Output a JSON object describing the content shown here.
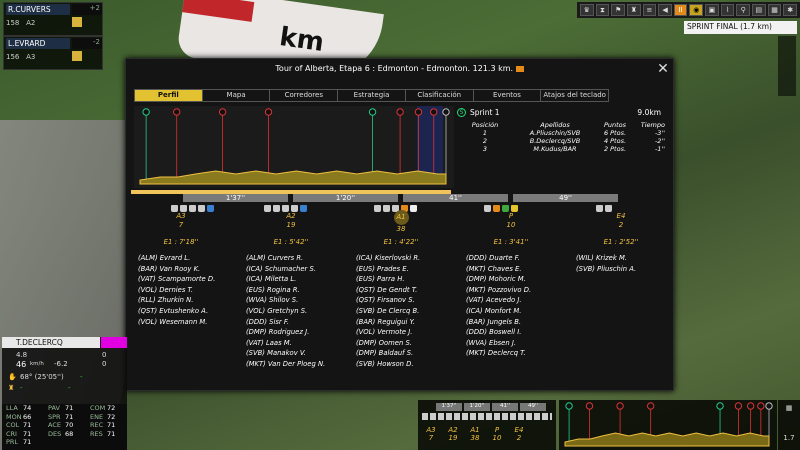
{
  "top_riders": [
    {
      "name": "R.CURVERS",
      "badge": "+2",
      "num": "158",
      "gap": "A2"
    },
    {
      "name": "L.EVRARD",
      "badge": "-2",
      "num": "156",
      "gap": "A3"
    }
  ],
  "toolbar": {
    "speed": "II",
    "sprint_final_label": "SPRINT FINAL (1.7 km)"
  },
  "banner_text": "km",
  "modal": {
    "title": "Tour of Alberta, Etapa 6 : Edmonton - Edmonton. 121.3 km.",
    "tabs": [
      "Perfil",
      "Mapa",
      "Corredores",
      "Estrategia",
      "Clasificación",
      "Eventos",
      "Atajos del teclado"
    ],
    "active_tab": "Perfil",
    "sprint": {
      "title": "Sprint 1",
      "distance": "9.0km",
      "headers": [
        "Posición",
        "Apellidos",
        "Puntos",
        "Tiempo"
      ],
      "rows": [
        [
          "1",
          "A.Pliuschin/SVB",
          "6 Ptos.",
          "-3''"
        ],
        [
          "2",
          "B.Declercq/SVB",
          "4 Ptos.",
          "-2''"
        ],
        [
          "3",
          "M.Kudus/BAR",
          "2 Ptos.",
          "-1''"
        ]
      ]
    },
    "gaps": [
      "1'37''",
      "1'20''",
      "41''",
      "49''"
    ],
    "groups": [
      {
        "label": "A3",
        "count": "7",
        "time": "E1 : 7'18''",
        "riders": [
          "(ALM) Evrard L.",
          "(BAR) Van Rooy K.",
          "(VAT) Scampamorte D.",
          "(VOL) Dernies T.",
          "(RLL) Zhurkin N.",
          "(QST) Evtushenko A.",
          "(VOL) Wesemann M."
        ]
      },
      {
        "label": "A2",
        "count": "19",
        "time": "E1 : 5'42''",
        "riders": [
          "(ALM) Curvers R.",
          "(ICA) Schumacher S.",
          "(ICA) Miletta L.",
          "(EUS) Rogina R.",
          "(WVA) Shilov S.",
          "(VOL) Gretchyn S.",
          "(DDD) Sisr F.",
          "(DMP) Rodriguez J.",
          "(VAT) Laas M.",
          "(SVB) Manakov V.",
          "(MKT) Van Der Ploeg N."
        ]
      },
      {
        "label": "A1",
        "count": "38",
        "time": "E1 : 4'22''",
        "riders": [
          "(ICA) Kiserlovski R.",
          "(EUS) Prades E.",
          "(EUS) Parra H.",
          "(QST) De Gendt T.",
          "(QST) Firsanov S.",
          "(SVB) De Clercq B.",
          "(BAR) Reguigui Y.",
          "(VOL) Vermote J.",
          "(DMP) Oomen S.",
          "(DMP) Baldauf S.",
          "(SVB) Howson D."
        ]
      },
      {
        "label": "P",
        "count": "10",
        "time": "E1 : 3'41''",
        "riders": [
          "(DDD) Duarte F.",
          "(MKT) Chaves E.",
          "(DMP) Mohoric M.",
          "(MKT) Pozzovivo D.",
          "(VAT) Acevedo J.",
          "(ICA) Monfort M.",
          "(BAR) Jungels B.",
          "(DDD) Boswell I.",
          "(WVA) Ebsen J.",
          "(MKT) Declercq T."
        ]
      },
      {
        "label": "E4",
        "count": "2",
        "time": "E1 : 2'52''",
        "riders": [
          "(WIL) Krizek M.",
          "(SVB) Pliuschin A."
        ]
      }
    ]
  },
  "rider_panel": {
    "name": "T.DECLERCQ",
    "val1": "4.8",
    "val2": "0",
    "speed": "46",
    "speed_unit": "km/h",
    "slope": "-6.2",
    "slope2": "0",
    "energy": "68° (25'05'')",
    "mod": "-",
    "stats": [
      [
        "LLA",
        "74"
      ],
      [
        "PAV",
        "71"
      ],
      [
        "COM",
        "72"
      ],
      [
        "MON",
        "66"
      ],
      [
        "SPR",
        "71"
      ],
      [
        "ENE",
        "72"
      ],
      [
        "COL",
        "71"
      ],
      [
        "ACE",
        "70"
      ],
      [
        "REC",
        "71"
      ],
      [
        "CRI",
        "71"
      ],
      [
        "DES",
        "68"
      ],
      [
        "RES",
        "71"
      ],
      [
        "PRL",
        "71"
      ]
    ]
  },
  "bottom_groups": {
    "labels": [
      "A3",
      "A2",
      "A1",
      "P",
      "E4"
    ],
    "counts": [
      "7",
      "19",
      "38",
      "10",
      "2"
    ],
    "gaps": [
      "1'37''",
      "1'20''",
      "41''",
      "49''"
    ]
  },
  "side_ctrl": {
    "value": "1.7"
  },
  "chart_data": {
    "type": "area",
    "title": "",
    "series": [
      {
        "values": [
          0,
          1,
          1,
          2,
          3,
          2,
          3,
          2,
          3,
          2,
          3,
          2,
          3,
          2,
          3,
          2,
          2
        ]
      }
    ],
    "x": [
      0,
      8,
      15,
      22,
      30,
      38,
      46,
      54,
      62,
      70,
      78,
      86,
      94,
      102,
      110,
      118,
      121.3
    ],
    "markers": [
      "sprint",
      "climb",
      "climb",
      "climb",
      "sprint",
      "climb",
      "climb",
      "climb",
      "finish"
    ]
  }
}
